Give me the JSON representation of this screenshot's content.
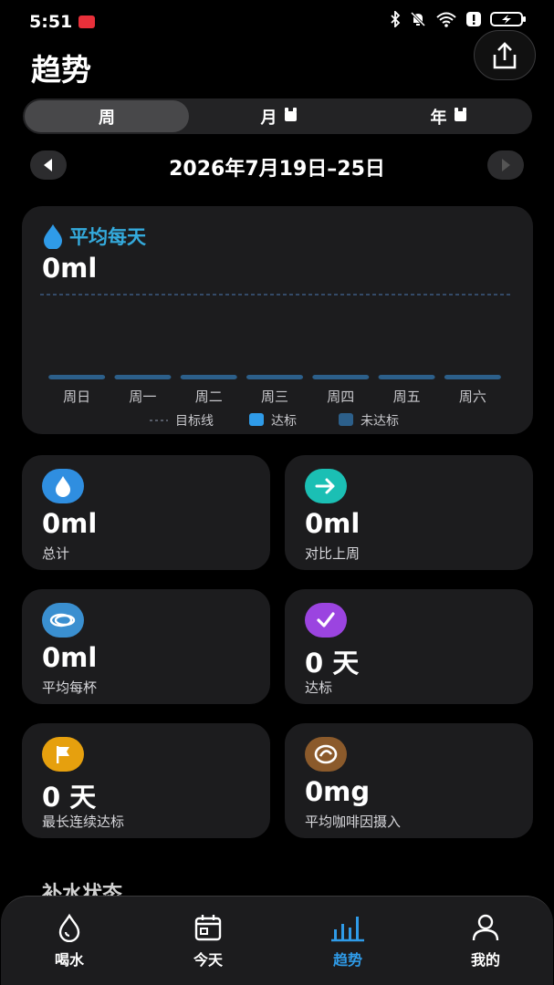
{
  "status_bar": {
    "time": "5:51"
  },
  "header": {
    "title": "趋势"
  },
  "tabs": [
    {
      "label": "周",
      "active": true,
      "locked": false
    },
    {
      "label": "月",
      "active": false,
      "locked": true
    },
    {
      "label": "年",
      "active": false,
      "locked": true
    }
  ],
  "date_range": {
    "label": "2026年7月19日–25日"
  },
  "chart_card": {
    "avg_label": "平均每天",
    "avg_value": "0ml"
  },
  "chart_data": {
    "type": "bar",
    "categories": [
      "周日",
      "周一",
      "周二",
      "周三",
      "周四",
      "周五",
      "周六"
    ],
    "values": [
      0,
      0,
      0,
      0,
      0,
      0,
      0
    ],
    "legend": [
      {
        "label": "目标线",
        "style": "dashed",
        "color": "#3d5a80"
      },
      {
        "label": "达标",
        "color": "#2f9be8"
      },
      {
        "label": "未达标",
        "color": "#2c5f8a"
      }
    ],
    "grid": false,
    "legend_position": "bottom"
  },
  "stats": [
    {
      "icon": "water-drop-icon",
      "color": "#2f8ee0",
      "value": "0ml",
      "label": "总计"
    },
    {
      "icon": "arrow-right-icon",
      "color": "#1bbfb4",
      "value": "0ml",
      "label": "对比上周"
    },
    {
      "icon": "cup-icon",
      "color": "#3a8fd0",
      "value": "0ml",
      "label": "平均每杯"
    },
    {
      "icon": "check-icon",
      "color": "#9b44e0",
      "value": "0 天",
      "label": "达标"
    },
    {
      "icon": "flag-icon",
      "color": "#e6a00e",
      "value": "0 天",
      "label": "最长连续达标"
    },
    {
      "icon": "coffee-icon",
      "color": "#8b5a2b",
      "value": "0mg",
      "label": "平均咖啡因摄入"
    }
  ],
  "section": {
    "title": "补水状态"
  },
  "bottom_nav": [
    {
      "label": "喝水",
      "icon": "water-drop-outline-icon",
      "active": false
    },
    {
      "label": "今天",
      "icon": "calendar-icon",
      "active": false
    },
    {
      "label": "趋势",
      "icon": "bar-chart-icon",
      "active": true
    },
    {
      "label": "我的",
      "icon": "person-icon",
      "active": false
    }
  ]
}
